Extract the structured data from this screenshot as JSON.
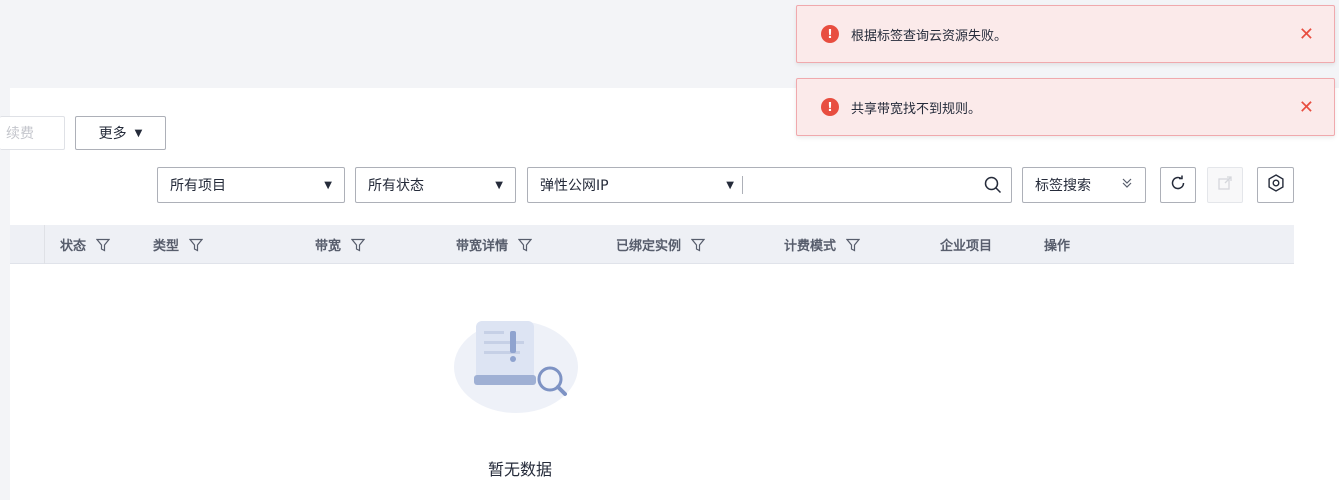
{
  "toolbar": {
    "renew_label": "续费",
    "more_label": "更多",
    "project_select": "所有项目",
    "status_select": "所有状态",
    "type_select": "弹性公网IP",
    "search_value": "",
    "tag_search_label": "标签搜索"
  },
  "table": {
    "columns": [
      {
        "label": "状态",
        "filter": true
      },
      {
        "label": "类型",
        "filter": true
      },
      {
        "label": "带宽",
        "filter": true
      },
      {
        "label": "带宽详情",
        "filter": true
      },
      {
        "label": "已绑定实例",
        "filter": true
      },
      {
        "label": "计费模式",
        "filter": true
      },
      {
        "label": "企业项目",
        "filter": false
      },
      {
        "label": "操作",
        "filter": false
      }
    ],
    "empty_text": "暂无数据"
  },
  "notifications": [
    {
      "message": "根据标签查询云资源失败。"
    },
    {
      "message": "共享带宽找不到规则。"
    }
  ],
  "colors": {
    "error": "#e84e40",
    "header_bg": "#eef0f5",
    "page_bg": "#f3f4f7"
  }
}
